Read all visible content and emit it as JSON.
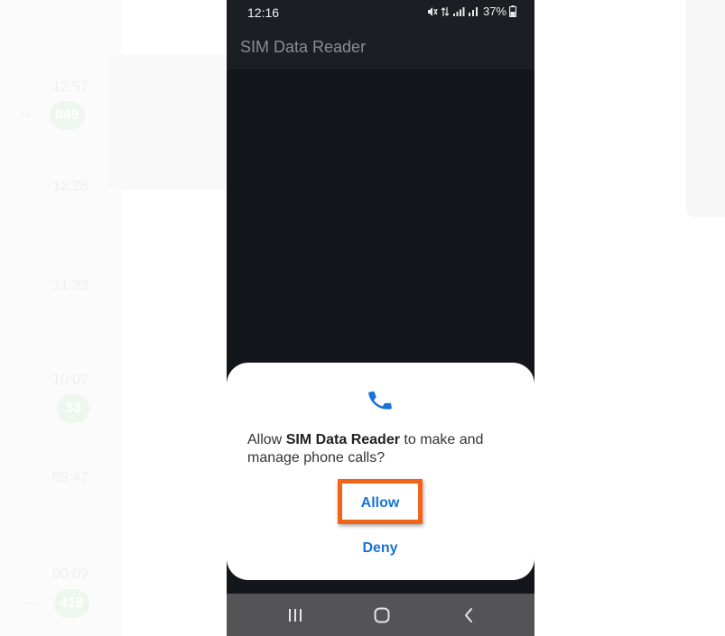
{
  "background": {
    "threads": [
      {
        "time": "12:57",
        "badge": "849",
        "prefix": "••"
      },
      {
        "time": "12:28",
        "badge": "",
        "prefix": ""
      },
      {
        "time": "11:33",
        "badge": "",
        "prefix": ""
      },
      {
        "time": "10:07",
        "badge": "33",
        "prefix": ""
      },
      {
        "time": "09:47",
        "badge": "",
        "prefix": ""
      },
      {
        "time": "00:09",
        "badge": "418",
        "prefix": "•••"
      }
    ]
  },
  "status_bar": {
    "time": "12:16",
    "signal_text": "⃠ ⇅ .∩l ∩l",
    "battery": "37%"
  },
  "app_bar": {
    "title": "SIM Data Reader"
  },
  "dialog": {
    "icon": "phone-icon",
    "message_prefix": "Allow ",
    "app_name": "SIM Data Reader",
    "message_suffix": " to make and manage phone calls?",
    "allow_label": "Allow",
    "deny_label": "Deny",
    "accent_color": "#1773d6",
    "highlight_color": "#f2641a"
  },
  "nav_bar": {
    "recent_icon": "recent-apps-icon",
    "home_icon": "home-icon",
    "back_icon": "back-icon"
  }
}
